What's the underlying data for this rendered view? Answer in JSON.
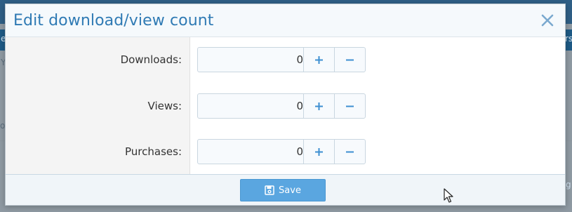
{
  "dialog": {
    "title": "Edit download/view count",
    "close_icon": "close-icon"
  },
  "fields": [
    {
      "label": "Downloads:",
      "value": "0"
    },
    {
      "label": "Views:",
      "value": "0"
    },
    {
      "label": "Purchases:",
      "value": "0"
    }
  ],
  "footer": {
    "save_label": "Save",
    "save_icon": "save-icon"
  },
  "background": {
    "fragment_left_1": "e",
    "fragment_left_2": "Y",
    "fragment_left_3": "o",
    "fragment_right_1": "rs",
    "fragment_right_2": "g"
  },
  "colors": {
    "title": "#2f7ab4",
    "accent_button": "#5aa6e0",
    "spin_icon": "#3d8fd1",
    "label_column": "#f4f4f4"
  }
}
